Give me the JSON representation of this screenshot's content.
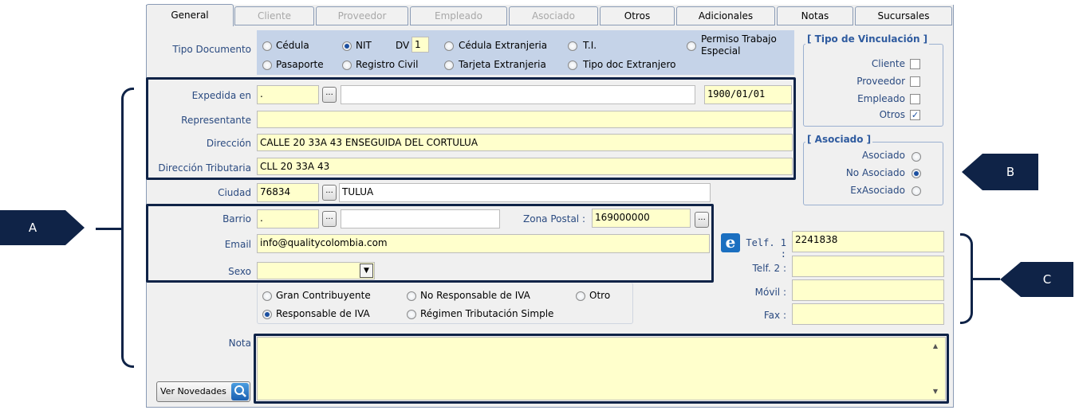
{
  "tabs": [
    {
      "label": "General",
      "state": "active"
    },
    {
      "label": "Cliente",
      "state": "disabled"
    },
    {
      "label": "Proveedor",
      "state": "disabled"
    },
    {
      "label": "Empleado",
      "state": "disabled"
    },
    {
      "label": "Asociado",
      "state": "disabled"
    },
    {
      "label": "Otros",
      "state": "enabled"
    },
    {
      "label": "Adicionales",
      "state": "enabled"
    },
    {
      "label": "Notas",
      "state": "enabled"
    },
    {
      "label": "Sucursales",
      "state": "enabled"
    }
  ],
  "tipo_documento": {
    "label": "Tipo Documento",
    "cedula": "Cédula",
    "nit": "NIT",
    "dv_label": "DV",
    "dv_value": "1",
    "cedula_ext": "Cédula Extranjeria",
    "ti": "T.I.",
    "permiso_line1": "Permiso Trabajo",
    "permiso_line2": "Especial",
    "pasaporte": "Pasaporte",
    "registro_civil": "Registro Civil",
    "tarjeta_ext": "Tarjeta Extranjeria",
    "tipo_doc_ext": "Tipo doc Extranjero",
    "selected": "NIT"
  },
  "form": {
    "expedida_label": "Expedida en",
    "expedida_code": ".",
    "expedida_date": "1900/01/01",
    "representante_label": "Representante",
    "representante_value": "",
    "direccion_label": "Dirección",
    "direccion_value": "CALLE 20 33A 43 ENSEGUIDA DEL CORTULUA",
    "dir_trib_label": "Dirección Tributaria",
    "dir_trib_value": "CLL 20 33A 43",
    "ciudad_label": "Ciudad",
    "ciudad_code": "76834",
    "ciudad_name": "TULUA",
    "barrio_label": "Barrio",
    "barrio_code": ".",
    "zona_label": "Zona Postal :",
    "zona_value": "169000000",
    "email_label": "Email",
    "email_value": "info@qualitycolombia.com",
    "sexo_label": "Sexo",
    "sexo_value": "",
    "nota_label": "Nota",
    "nota_value": "",
    "browse": "..."
  },
  "tributario": {
    "gran": "Gran Contribuyente",
    "no_resp": "No Responsable de IVA",
    "otro": "Otro",
    "resp": "Responsable de IVA",
    "regimen": "Régimen Tributación Simple",
    "selected": "Responsable de IVA"
  },
  "vinculacion": {
    "title": "[ Tipo de Vinculación ]",
    "items": [
      {
        "label": "Cliente",
        "checked": false
      },
      {
        "label": "Proveedor",
        "checked": false
      },
      {
        "label": "Empleado",
        "checked": false
      },
      {
        "label": "Otros",
        "checked": true
      }
    ]
  },
  "asociado": {
    "title": "[ Asociado ]",
    "items": [
      {
        "label": "Asociado",
        "selected": false
      },
      {
        "label": "No Asociado",
        "selected": true
      },
      {
        "label": "ExAsociado",
        "selected": false
      }
    ]
  },
  "telefonos": {
    "telf1_label": "Telf. 1 :",
    "telf1_value": "2241838",
    "telf2_label": "Telf. 2 :",
    "telf2_value": "",
    "movil_label": "Móvil :",
    "movil_value": "",
    "fax_label": "Fax :",
    "fax_value": ""
  },
  "ver_novedades": "Ver Novedades",
  "callouts": {
    "a": "A",
    "b": "B",
    "c": "C"
  },
  "colors": {
    "field_bg": "#ffffcc",
    "header_bg": "#c5d3e8",
    "callout": "#0f2347",
    "accent": "#1b4fa0"
  }
}
